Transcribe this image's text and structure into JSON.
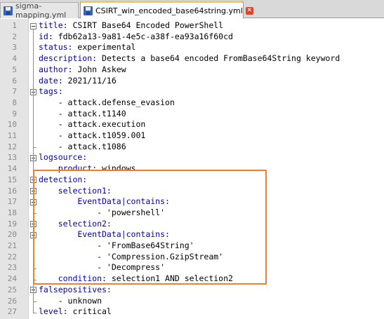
{
  "tabs": [
    {
      "label": "sigma-mapping.yml",
      "active": false
    },
    {
      "label": "CSIRT_win_encoded_base64string.yml",
      "active": true
    }
  ],
  "lines": [
    {
      "n": "1",
      "key": "title:",
      "val": " CSIRT Base64 Encoded PowerShell"
    },
    {
      "n": "2",
      "key": "id:",
      "val": " fdb62a13-9a81-4e5c-a38f-ea93a16f60cd"
    },
    {
      "n": "3",
      "key": "status:",
      "val": " experimental"
    },
    {
      "n": "4",
      "key": "description:",
      "val": " Detects a base64 encoded FromBase64String keyword"
    },
    {
      "n": "5",
      "key": "author:",
      "val": " John Askew"
    },
    {
      "n": "6",
      "key": "date:",
      "val": " 2021/11/16"
    },
    {
      "n": "7",
      "key": "tags:",
      "val": ""
    },
    {
      "n": "8",
      "key": "",
      "val": "    - attack.defense_evasion"
    },
    {
      "n": "9",
      "key": "",
      "val": "    - attack.t1140"
    },
    {
      "n": "10",
      "key": "",
      "val": "    - attack.execution"
    },
    {
      "n": "11",
      "key": "",
      "val": "    - attack.t1059.001"
    },
    {
      "n": "12",
      "key": "",
      "val": "    - attack.t1086"
    },
    {
      "n": "13",
      "key": "logsource:",
      "val": ""
    },
    {
      "n": "14",
      "key": "    product:",
      "val": " windows"
    },
    {
      "n": "15",
      "key": "detection:",
      "val": ""
    },
    {
      "n": "16",
      "key": "    selection1:",
      "val": ""
    },
    {
      "n": "17",
      "key": "        EventData|contains:",
      "val": ""
    },
    {
      "n": "18",
      "key": "",
      "val": "            - 'powershell'"
    },
    {
      "n": "19",
      "key": "    selection2:",
      "val": ""
    },
    {
      "n": "20",
      "key": "        EventData|contains:",
      "val": ""
    },
    {
      "n": "21",
      "key": "",
      "val": "            - 'FromBase64String'"
    },
    {
      "n": "22",
      "key": "",
      "val": "            - 'Compression.GzipStream'"
    },
    {
      "n": "23",
      "key": "",
      "val": "            - 'Decompress'"
    },
    {
      "n": "24",
      "key": "    condition:",
      "val": " selection1 AND selection2"
    },
    {
      "n": "25",
      "key": "falsepositives:",
      "val": ""
    },
    {
      "n": "26",
      "key": "",
      "val": "    - unknown"
    },
    {
      "n": "27",
      "key": "level:",
      "val": " critical"
    }
  ],
  "colors": {
    "key": "#0000b4",
    "highlight": "#e8822f",
    "tab_accent": "#f9c94d"
  }
}
